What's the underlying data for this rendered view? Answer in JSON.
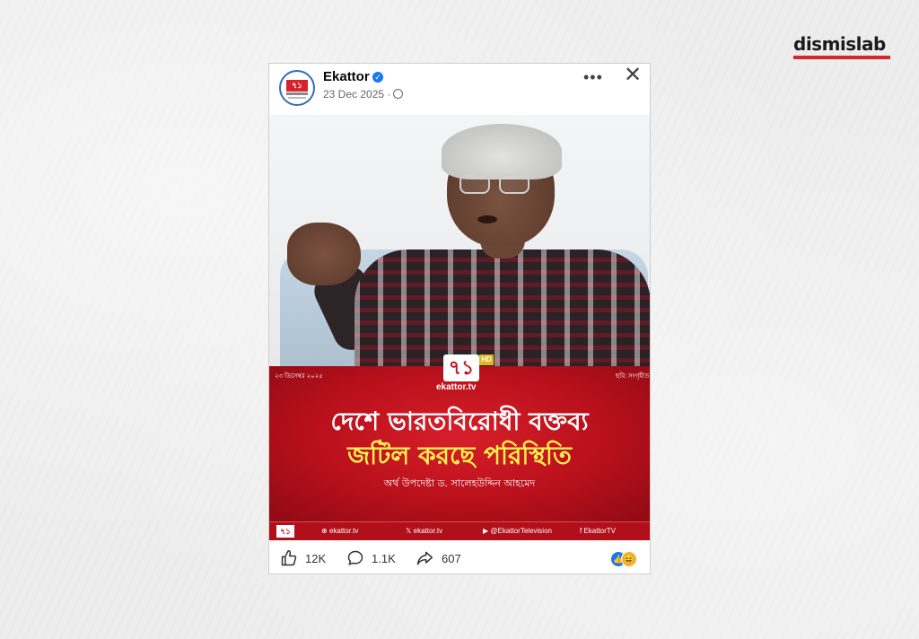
{
  "brand": {
    "name": "dismislab",
    "accent": "#d9252b"
  },
  "post": {
    "page_name": "Ekattor",
    "verified_icon": "verified-check-icon",
    "date": "23 Dec 2025",
    "separator": "·",
    "privacy_icon": "globe-icon",
    "more_label": "•••",
    "close_label": "✕",
    "avatar_text": "৭১"
  },
  "graphic": {
    "date_bn": "২৩ ডিসেম্বর ২০২৫",
    "credit_bn": "ছবি: সংগৃহীত",
    "logo_mark": "৭১",
    "logo_hd": "HD",
    "logo_text": "ekattor.tv",
    "headline_line1": "দেশে ভারতবিরোধী বক্তব্য",
    "headline_line2": "জটিল করছে পরিস্থিতি",
    "speaker": "অর্থ উপদেষ্টা ড. সালেহউদ্দিন আহমেদ",
    "banner_color": "#c4141e",
    "headline2_color": "#fff14d",
    "footer": {
      "logo": "৭১",
      "web": "ekattor.tv",
      "x": "ekattor.tv",
      "youtube": "@EkattorTelevision",
      "facebook": "EkattorTV"
    }
  },
  "actions": {
    "likes": "12K",
    "comments": "1.1K",
    "shares": "607",
    "reaction_like": "👍",
    "reaction_haha": "😆"
  }
}
